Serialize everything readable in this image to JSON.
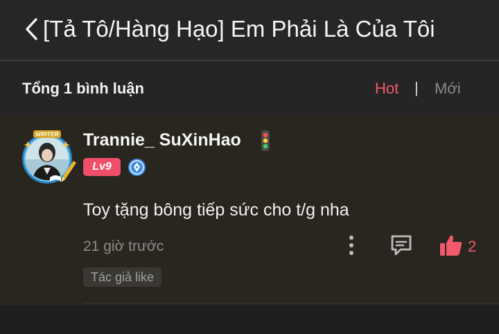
{
  "header": {
    "title": "[Tả Tô/Hàng Hạo] Em Phải Là Của Tôi",
    "back_icon": "chevron-left-icon"
  },
  "comments_bar": {
    "count_label": "Tổng 1 bình luận",
    "sort_hot": "Hot",
    "separator": "|",
    "sort_new": "Mới"
  },
  "comment": {
    "avatar_badge": "WRITER",
    "username": "Trannie_ SuXinHao",
    "status_icon": "traffic-light-icon",
    "level": "Lv9",
    "writer_icon": "pen-nib-icon",
    "text": "Toy tặng bông tiếp sức cho t/g nha",
    "time": "21 giờ trước",
    "like_count": "2",
    "author_tag": "Tác giả like"
  },
  "colors": {
    "accent": "#f25a6b",
    "header_bg": "#262626",
    "comment_bg": "#29261f",
    "muted_text": "#8d8d8d"
  }
}
